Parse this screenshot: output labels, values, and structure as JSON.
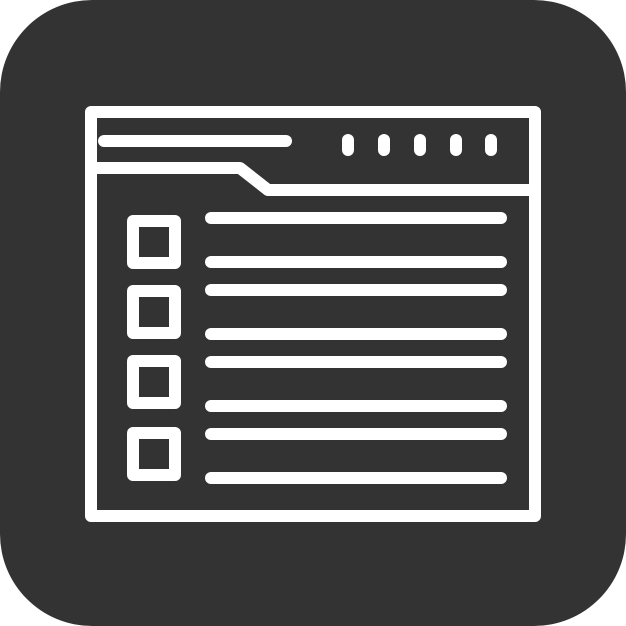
{
  "icon": {
    "name": "browser-window-checklist-icon",
    "background_color": "#333333",
    "stroke_color": "#ffffff",
    "window_dots_count": 5,
    "checklist_rows": [
      {
        "checked": false
      },
      {
        "checked": false
      },
      {
        "checked": false
      },
      {
        "checked": false
      }
    ]
  }
}
